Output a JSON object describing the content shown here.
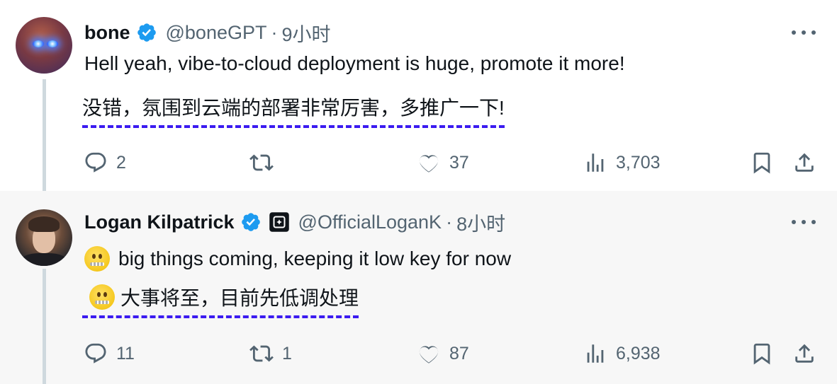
{
  "tweets": [
    {
      "author": {
        "name": "bone",
        "handle": "@boneGPT",
        "separator": "·",
        "time": "9小时"
      },
      "text": "Hell yeah, vibe-to-cloud deployment is huge, promote it more!",
      "translation": "没错，氛围到云端的部署非常厉害，多推广一下!",
      "stats": {
        "replies": "2",
        "retweets": "",
        "likes": "37",
        "views": "3,703"
      }
    },
    {
      "author": {
        "name": "Logan Kilpatrick",
        "handle": "@OfficialLoganK",
        "separator": "·",
        "time": "8小时"
      },
      "text": "big things coming, keeping it low key for now",
      "translation": "大事将至，目前先低调处理",
      "stats": {
        "replies": "11",
        "retweets": "1",
        "likes": "87",
        "views": "6,938"
      }
    }
  ],
  "icons": {
    "verified": "verified-badge-icon",
    "affiliate": "affiliate-badge-icon",
    "more": "more-icon",
    "reply": "reply-icon",
    "retweet": "retweet-icon",
    "like": "heart-icon",
    "views": "views-icon",
    "bookmark": "bookmark-icon",
    "share": "share-icon",
    "emoji": "zipper-mouth-face-emoji"
  },
  "colors": {
    "verified": "#1d9bf0",
    "translation_underline": "#3b1bf0",
    "muted_text": "#536471",
    "reply_background": "#f7f7f7"
  }
}
